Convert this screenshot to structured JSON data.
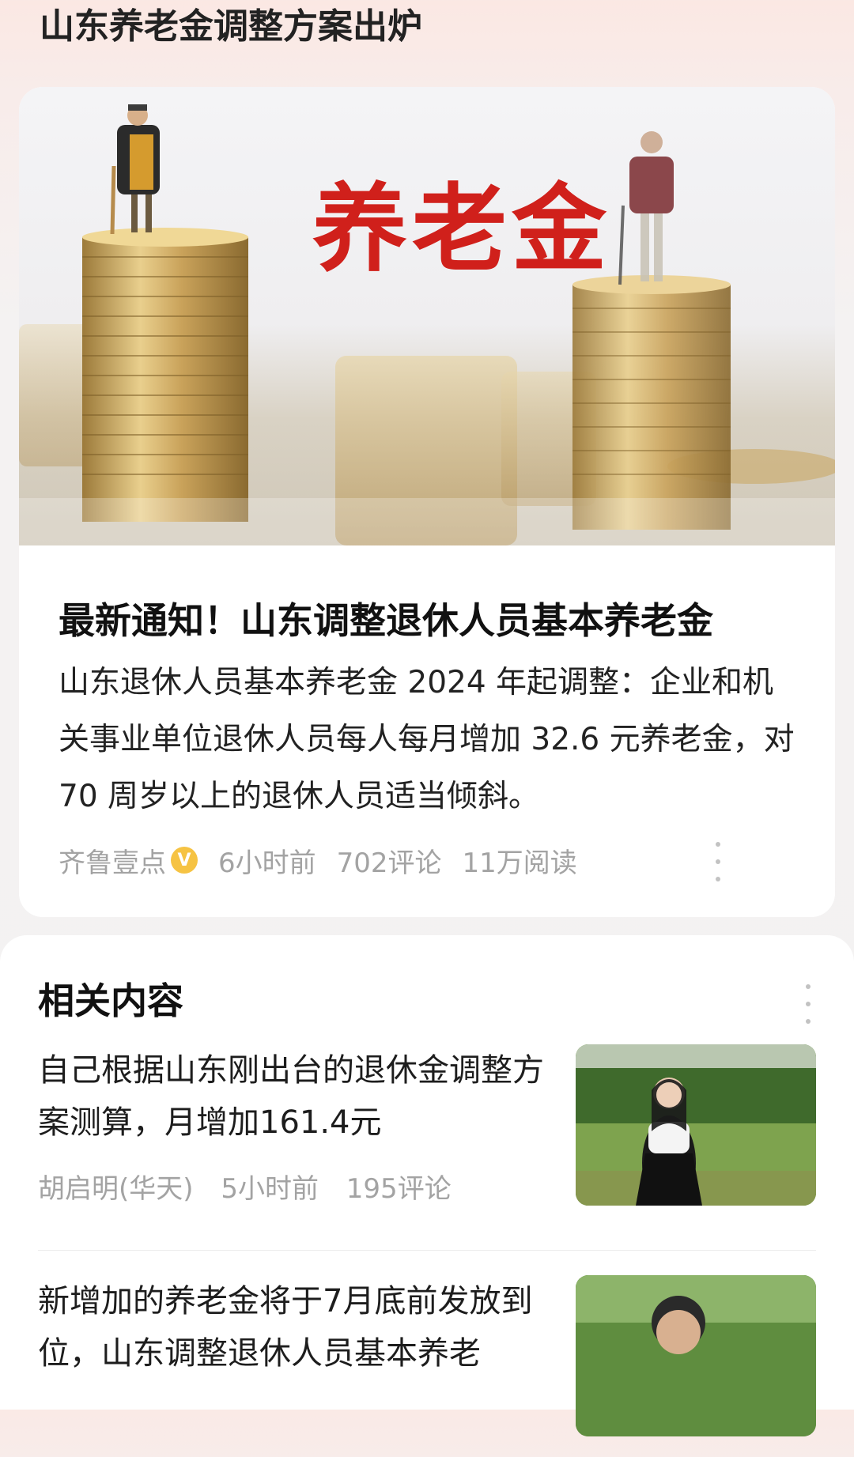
{
  "header": {
    "title": "山东养老金调整方案出炉"
  },
  "hero": {
    "image_text": "养老金",
    "title": "最新通知！山东调整退休人员基本养老金",
    "summary": "山东退休人员基本养老金 2024 年起调整：企业和机关事业单位退休人员每人每月增加 32.6 元养老金，对 70 周岁以上的退休人员适当倾斜。",
    "source": "齐鲁壹点",
    "verified_badge": "V",
    "time": "6小时前",
    "comments": "702评论",
    "reads": "11万阅读",
    "menu_icon": "more-vertical-icon"
  },
  "related": {
    "title": "相关内容",
    "items": [
      {
        "title": "自己根据山东刚出台的退休金调整方案测算，月增加161.4元",
        "author": "胡启明(华天)",
        "time": "5小时前",
        "comments": "195评论"
      },
      {
        "title": "新增加的养老金将于7月底前发放到位，山东调整退休人员基本养老"
      }
    ]
  },
  "colors": {
    "accent_red": "#d0201b",
    "badge_yellow": "#f6c343",
    "meta_gray": "#a3a3a3"
  }
}
